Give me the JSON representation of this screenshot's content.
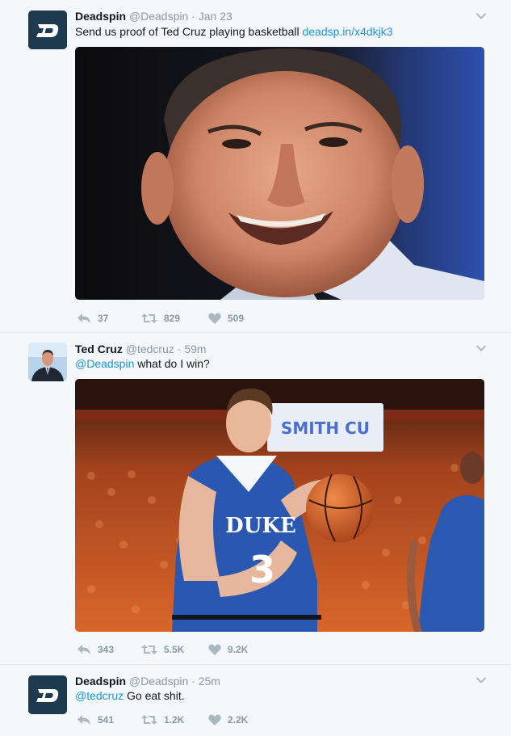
{
  "tweets": [
    {
      "name": "Deadspin",
      "handle": "@Deadspin",
      "time": "Jan 23",
      "text_prefix": "Send us proof of Ted Cruz playing basketball ",
      "text_link": "deadsp.in/x4dkjk3",
      "reply_count": "37",
      "retweet_count": "829",
      "like_count": "509"
    },
    {
      "name": "Ted Cruz",
      "handle": "@tedcruz",
      "time": "59m",
      "text_mention": "@Deadspin",
      "text_suffix": " what do I win?",
      "reply_count": "343",
      "retweet_count": "5.5K",
      "like_count": "9.2K",
      "jersey_text": "DUKE",
      "jersey_number": "3",
      "banner_text": "SMITH CU"
    },
    {
      "name": "Deadspin",
      "handle": "@Deadspin",
      "time": "25m",
      "text_mention": "@tedcruz",
      "text_suffix": " Go eat shit.",
      "reply_count": "541",
      "retweet_count": "1.2K",
      "like_count": "2.2K"
    }
  ],
  "dot": "·",
  "logo_letter": "D",
  "colors": {
    "background": "#f5f8fa",
    "link": "#1b95e0",
    "muted": "#8899a6",
    "deadspin_brand": "#1d3a4f",
    "duke_blue": "#2a58b0"
  },
  "icons": {
    "reply": "reply-icon",
    "retweet": "retweet-icon",
    "like": "heart-icon",
    "caret": "chevron-down-icon"
  }
}
